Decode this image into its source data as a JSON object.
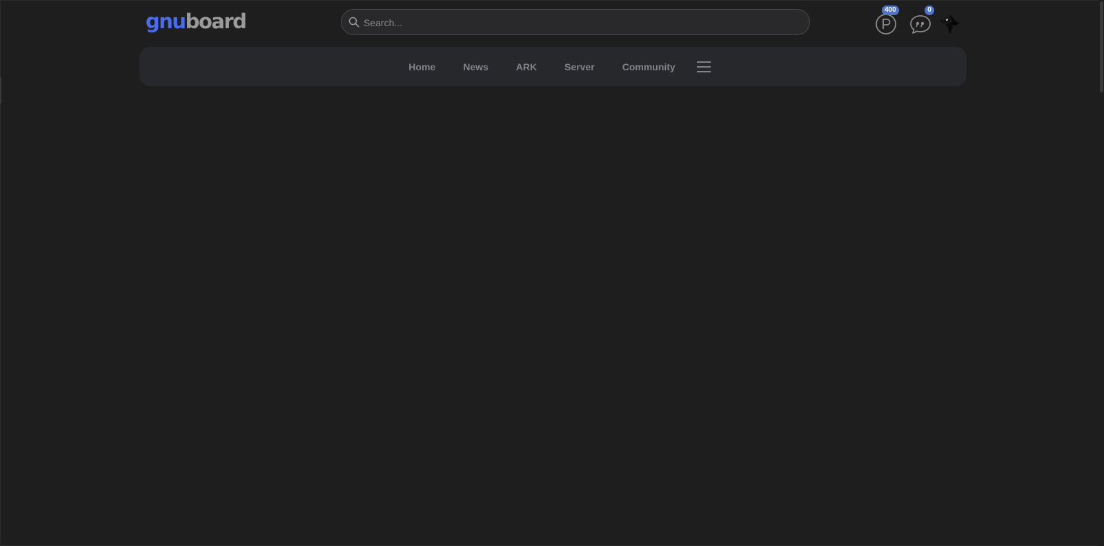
{
  "header": {
    "logo": {
      "part1": "gnu",
      "part2": "board",
      "part1_color": "#4a6cf0",
      "part2_color": "#9a9a9a"
    },
    "search": {
      "placeholder": "Search...",
      "value": ""
    },
    "points": {
      "icon": "point-p-icon",
      "count": "400"
    },
    "messages": {
      "icon": "chat-bubble-icon",
      "count": "0"
    },
    "avatar": {
      "icon": "user-avatar-icon"
    }
  },
  "nav": {
    "items": [
      {
        "label": "Home"
      },
      {
        "label": "News"
      },
      {
        "label": "ARK"
      },
      {
        "label": "Server"
      },
      {
        "label": "Community"
      }
    ],
    "menu_icon": "hamburger-menu-icon"
  },
  "colors": {
    "background": "#1e1e1e",
    "nav_background": "#27282b",
    "badge": "#4f74c8",
    "accent": "#4a6cf0"
  }
}
